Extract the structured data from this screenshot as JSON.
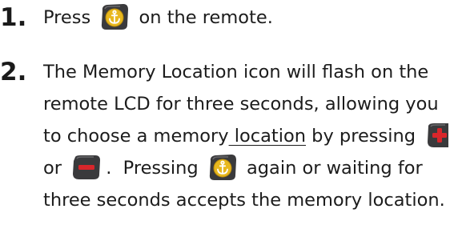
{
  "steps": [
    {
      "number": "1.",
      "line1_pre": "Press",
      "line1_post": "on the remote.",
      "icon": "anchor-button-icon"
    },
    {
      "number": "2.",
      "line1": "The Memory Location icon will flash on the",
      "line2": "remote LCD for three seconds, allowing you",
      "line3_pre": "to choose a memory",
      "line3_underlined": " location",
      "line3_post": " by pressing",
      "line4_pre": "or",
      "line4_mid": ".  Pressing",
      "line4_post": "again or waiting for",
      "line5": "three seconds accepts the memory location.",
      "icons": [
        "plus-button-icon",
        "minus-button-icon",
        "anchor-button-icon"
      ]
    }
  ],
  "colors": {
    "button_body": "#3a3a3c",
    "anchor_disc": "#e8b81e",
    "plus_minus_red": "#d8262b"
  }
}
